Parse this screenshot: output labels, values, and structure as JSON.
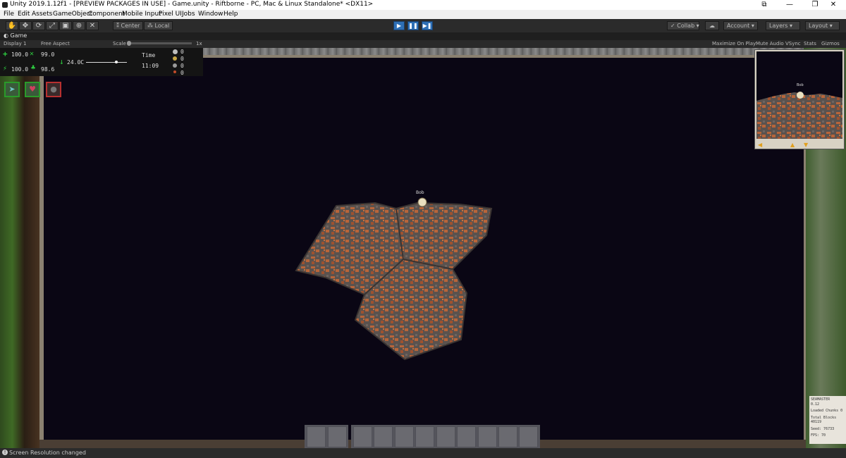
{
  "window": {
    "title": "Unity 2019.1.12f1 - [PREVIEW PACKAGES IN USE] - Game.unity - Riftborne - PC, Mac & Linux Standalone* <DX11>",
    "controls": [
      "⧉",
      "—",
      "❐",
      "✕"
    ]
  },
  "menu": [
    "File",
    "Edit",
    "Assets",
    "GameObject",
    "Component",
    "Mobile Input",
    "Pixel UI",
    "Jobs",
    "Window",
    "Help"
  ],
  "toolbar": {
    "tools": [
      "✋",
      "✥",
      "⟳",
      "⤢",
      "▣",
      "⊕",
      "✕"
    ],
    "pivot": "Center",
    "space": "Local",
    "play": [
      "▶",
      "❚❚",
      "▶❚"
    ],
    "collab": "Collab",
    "account": "Account",
    "layers": "Layers",
    "layout": "Layout"
  },
  "game_tab": {
    "title": "Game",
    "display": "Display 1",
    "aspect": "Free Aspect",
    "scale_label": "Scale",
    "scale_value": "1x",
    "options": [
      "Maximize On Play",
      "Mute Audio",
      "VSync",
      "Stats",
      "Gizmos"
    ]
  },
  "hud": {
    "health": "100.0",
    "hunger": "99.0",
    "energy": "100.0",
    "oxygen": "98.6",
    "temperature": "24.0C",
    "time_label": "Time",
    "time_value": "11:09",
    "resources": [
      "0",
      "0",
      "0",
      "0"
    ],
    "resource_colors": [
      "#bdbdbd",
      "#c7a646",
      "#9a9a9a",
      "#c24b2a"
    ]
  },
  "player": {
    "name": "Bob"
  },
  "minimap": {
    "player_name": "Bob"
  },
  "debug": {
    "line1": "SEAMASTER",
    "line2": "0.12",
    "line3": "Loaded Chunks 0",
    "line4": "Total Blocks",
    "line5": "40119",
    "line6": "Seed: 76733",
    "line7": "FPS: 70"
  },
  "status": {
    "message": "Screen Resolution changed"
  },
  "colors": {
    "space": "#0a0614",
    "rock_orange": "#b8653a",
    "rock_gray": "#5a524e",
    "hud_green": "#2ecc40",
    "play_blue": "#2e6fb5"
  }
}
